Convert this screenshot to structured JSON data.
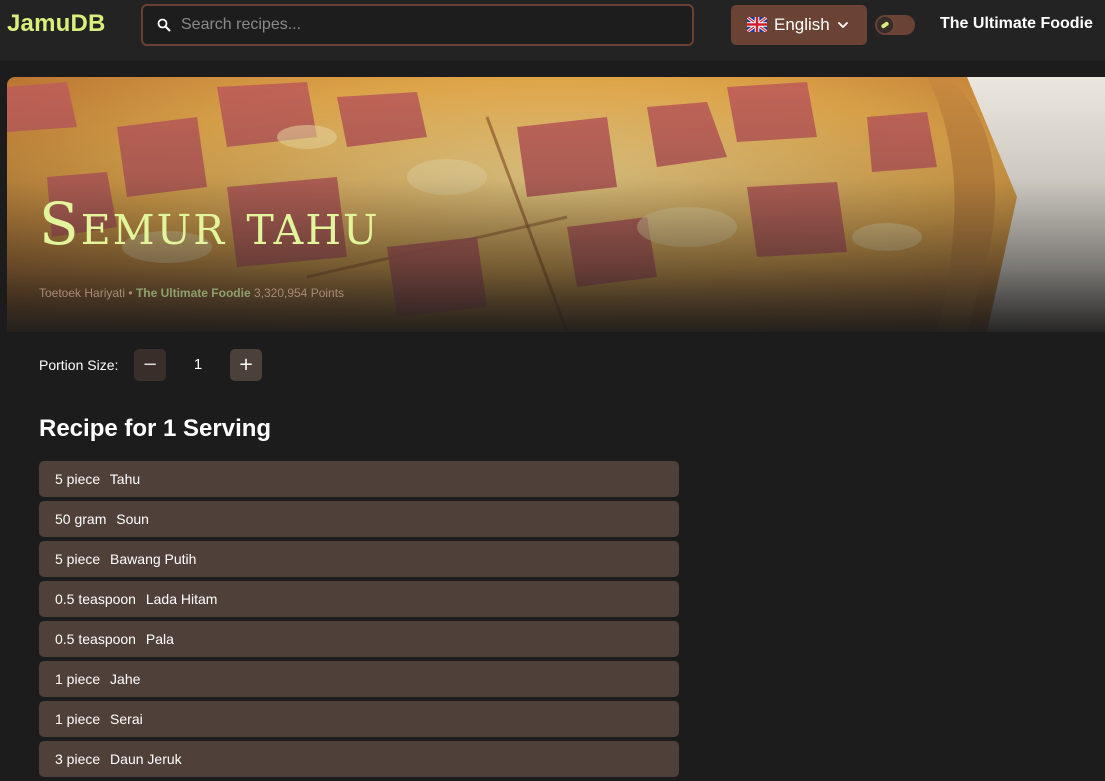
{
  "header": {
    "logo": "JamuDB",
    "search_placeholder": "Search recipes...",
    "language": "English",
    "user_title": "The Ultimate Foodie"
  },
  "recipe": {
    "title": "Semur tahu",
    "author": "Toetoek Hariyati",
    "separator": "•",
    "author_badge": "The Ultimate Foodie",
    "author_points": "3,320,954 Points"
  },
  "portion": {
    "label": "Portion Size:",
    "value": "1",
    "minus": "−",
    "plus": "+"
  },
  "recipe_heading": "Recipe for 1 Serving",
  "ingredients": [
    {
      "qty": "5 piece",
      "name": "Tahu"
    },
    {
      "qty": "50 gram",
      "name": "Soun"
    },
    {
      "qty": "5 piece",
      "name": "Bawang Putih"
    },
    {
      "qty": "0.5 teaspoon",
      "name": "Lada Hitam"
    },
    {
      "qty": "0.5 teaspoon",
      "name": "Pala"
    },
    {
      "qty": "1 piece",
      "name": "Jahe"
    },
    {
      "qty": "1 piece",
      "name": "Serai"
    },
    {
      "qty": "3 piece",
      "name": "Daun Jeruk"
    }
  ],
  "colors": {
    "accent": "#d9ef7b",
    "brown": "#6b4335",
    "ingredient_bg": "#4f403a",
    "background": "#1c1c1c"
  },
  "icons": {
    "search": "search-icon",
    "flag": "uk-flag-icon",
    "chevron": "chevron-down-icon",
    "toggle": "theme-toggle"
  }
}
